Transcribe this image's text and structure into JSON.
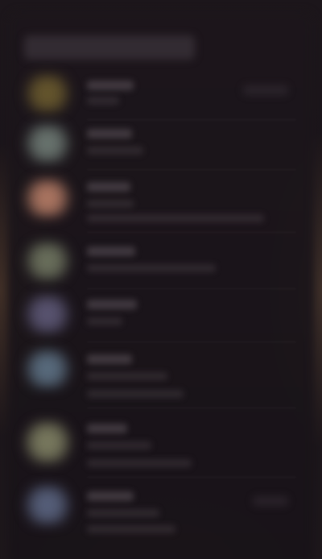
{
  "screen": {
    "title": ""
  },
  "list": {
    "items": [
      {
        "icon": "app-icon",
        "title": "",
        "subtitle": "",
        "icon_color": "#6a5a2e"
      },
      {
        "icon": "app-icon",
        "title": "",
        "subtitle": "",
        "icon_color": "#6e7a74"
      },
      {
        "icon": "app-icon",
        "title": "",
        "subtitle": "",
        "icon_color": "#b57c66"
      },
      {
        "icon": "app-icon",
        "title": "",
        "subtitle": "",
        "icon_color": "#6f7560"
      },
      {
        "icon": "app-icon",
        "title": "",
        "subtitle": "",
        "icon_color": "#5d5876"
      },
      {
        "icon": "app-icon",
        "title": "",
        "subtitle": "",
        "icon_color": "#5d7184"
      },
      {
        "icon": "app-icon",
        "title": "",
        "subtitle": "",
        "icon_color": "#7f8063"
      },
      {
        "icon": "app-icon",
        "title": "",
        "subtitle": "",
        "icon_color": "#5a6480"
      }
    ]
  }
}
